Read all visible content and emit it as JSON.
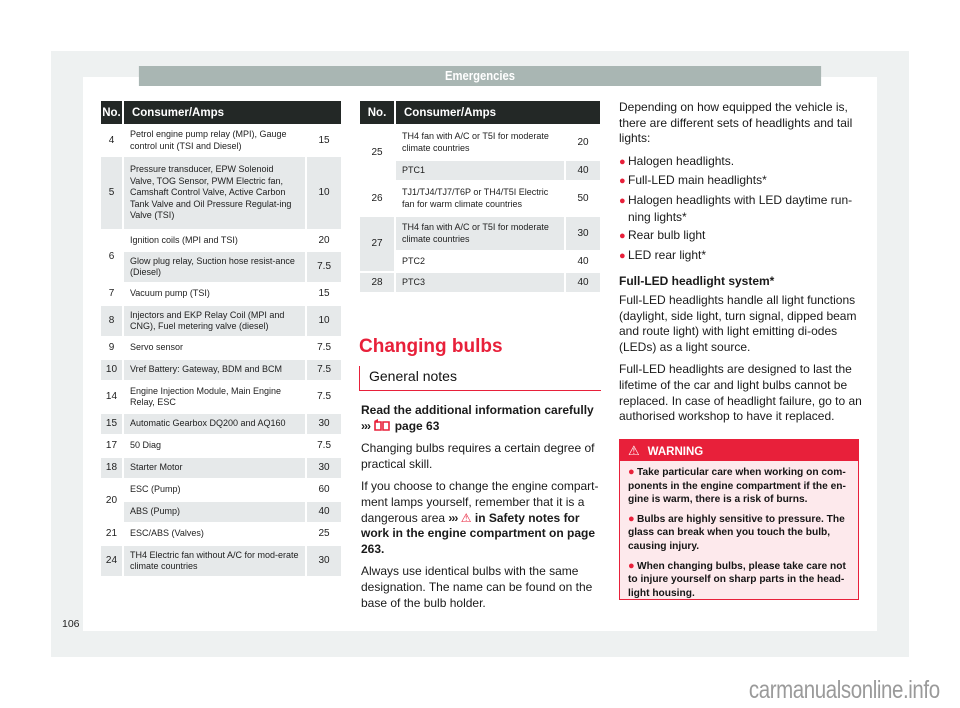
{
  "header": {
    "title": "Emergencies"
  },
  "fuse_table_left": {
    "columns": [
      "No.",
      "Consumer/Amps"
    ],
    "rows": [
      {
        "no": "4",
        "consumer": "Petrol engine pump relay (MPI), Gauge control unit (TSI and Diesel)",
        "amps": "15"
      },
      {
        "no": "5",
        "consumer": "Pressure transducer, EPW Solenoid Valve, TOG Sensor, PWM Electric fan, Camshaft Control Valve, Active Carbon Tank Valve and Oil Pressure Regulat-ing Valve (TSI)",
        "amps": "10"
      },
      {
        "no": "6",
        "consumer": "Ignition coils (MPI and TSI)",
        "amps": "20"
      },
      {
        "no": "",
        "consumer": "Glow plug relay, Suction hose resist-ance (Diesel)",
        "amps": "7.5"
      },
      {
        "no": "7",
        "consumer": "Vacuum pump (TSI)",
        "amps": "15"
      },
      {
        "no": "8",
        "consumer": "Injectors and EKP Relay Coil (MPI and CNG), Fuel metering valve (diesel)",
        "amps": "10"
      },
      {
        "no": "9",
        "consumer": "Servo sensor",
        "amps": "7.5"
      },
      {
        "no": "10",
        "consumer": "Vref Battery: Gateway, BDM and BCM",
        "amps": "7.5"
      },
      {
        "no": "14",
        "consumer": "Engine Injection Module, Main Engine Relay, ESC",
        "amps": "7.5"
      },
      {
        "no": "15",
        "consumer": "Automatic Gearbox DQ200 and AQ160",
        "amps": "30"
      },
      {
        "no": "17",
        "consumer": "50 Diag",
        "amps": "7.5"
      },
      {
        "no": "18",
        "consumer": "Starter Motor",
        "amps": "30"
      },
      {
        "no": "20",
        "consumer": "ESC (Pump)",
        "amps": "60"
      },
      {
        "no": "",
        "consumer": "ABS (Pump)",
        "amps": "40"
      },
      {
        "no": "21",
        "consumer": "ESC/ABS (Valves)",
        "amps": "25"
      },
      {
        "no": "24",
        "consumer": "TH4 Electric fan without A/C for mod-erate climate countries",
        "amps": "30"
      }
    ]
  },
  "fuse_table_mid": {
    "columns": [
      "No.",
      "Consumer/Amps"
    ],
    "rows": [
      {
        "no": "25",
        "consumer": "TH4 fan with A/C or T5I for moderate climate countries",
        "amps": "20"
      },
      {
        "no": "",
        "consumer": "PTC1",
        "amps": "40"
      },
      {
        "no": "26",
        "consumer": "TJ1/TJ4/TJ7/T6P or TH4/T5I Electric fan for warm climate countries",
        "amps": "50"
      },
      {
        "no": "27",
        "consumer": "TH4 fan with A/C or T5I for moderate climate countries",
        "amps": "30"
      },
      {
        "no": "",
        "consumer": "PTC2",
        "amps": "40"
      },
      {
        "no": "28",
        "consumer": "PTC3",
        "amps": "40"
      }
    ]
  },
  "section": {
    "title": "Changing bulbs",
    "subtitle": "General notes"
  },
  "mid_text": {
    "read_info": "Read the additional information carefully",
    "read_arrows": "›››",
    "read_page": "page 63",
    "p1": "Changing bulbs requires a certain degree of practical skill.",
    "p2_start": "If you choose to change the engine compart-ment lamps yourself, remember that it is a dangerous area",
    "p2_arrows": "›››",
    "p2_link": "in Safety notes for work in the engine compartment on page 263",
    "p2_end": ".",
    "p3": "Always use identical bulbs with the same designation. The name can be found on the base of the bulb holder."
  },
  "right_col": {
    "intro": "Depending on how equipped the vehicle is, there are different sets of headlights and tail lights:",
    "bullets": [
      "Halogen headlights.",
      "Full-LED main headlights*",
      "Halogen headlights with LED daytime run-ning lights*",
      "Rear bulb light",
      "LED rear light*"
    ],
    "subtitle": "Full-LED headlight system*",
    "p1": "Full-LED headlights handle all light functions (daylight, side light, turn signal, dipped beam and route light) with light emitting di-odes (LEDs) as a light source.",
    "p2": "Full-LED headlights are designed to last the lifetime of the car and light bulbs cannot be replaced. In case of headlight failure, go to an authorised workshop to have it replaced."
  },
  "warning": {
    "title": "WARNING",
    "items": [
      "Take particular care when working on com-ponents in the engine compartment if the en-gine is warm, there is a risk of burns.",
      "Bulbs are highly sensitive to pressure. The glass can break when you touch the bulb, causing injury.",
      "When changing bulbs, please take care not to injure yourself on sharp parts in the head-light housing."
    ]
  },
  "colors": {
    "accent": "#e8203a",
    "header_bar": "#a9b6b3",
    "table_head": "#232826",
    "row_alt": "#e6e9ea",
    "warning_bg": "#fde9ec"
  },
  "footer": {
    "page_number": "106",
    "watermark": "carmanualsonline.info"
  }
}
